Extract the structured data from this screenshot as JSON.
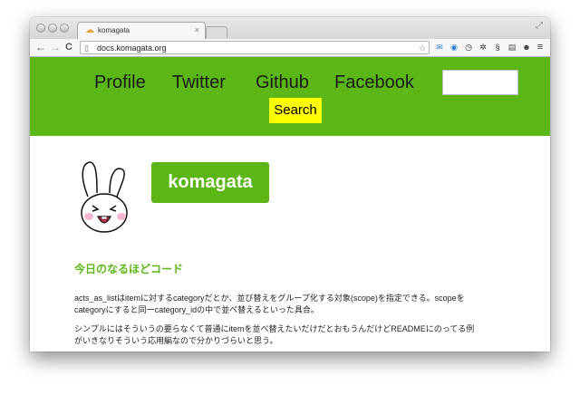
{
  "browser": {
    "tab_title": "komagata",
    "tab_close": "×",
    "url": "docs.komagata.org",
    "back": "←",
    "forward": "→",
    "reload": "C",
    "menu": "≡",
    "star": "☆"
  },
  "nav": {
    "items": [
      "Profile",
      "Twitter",
      "Github",
      "Facebook"
    ],
    "search_label": "Search",
    "search_value": ""
  },
  "logo": {
    "text": "komagata"
  },
  "content": {
    "heading": "今日のなるほどコード",
    "p1_line1": "acts_as_listはitemに対するcategoryだとか、並び替えをグループ化する対象(scope)を指定できる。scopeを",
    "p1_line2": "categoryにすると同一category_idの中で並べ替えるといった具合。",
    "p2_line1": "シンプルにはそういうの要らなくて普通にitemを並べ替えたいだけだとおもうんだけどREADMEにのってる例",
    "p2_line2": "がいきなりそういう応用編なので分かりづらいと思う。"
  },
  "colors": {
    "banner": "#5cb716",
    "search_button": "#ffff00"
  }
}
